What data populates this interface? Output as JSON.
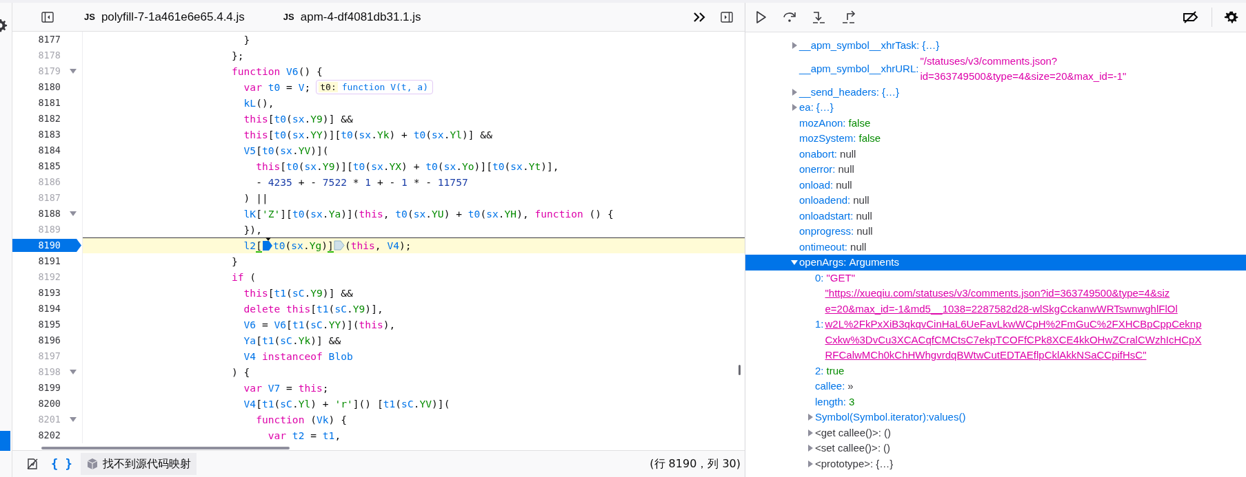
{
  "editor": {
    "tabs": [
      {
        "icon": "JS",
        "label": "polyfill-7-1a461e6e65.4.4.js",
        "selected": false
      },
      {
        "icon": "JS",
        "label": "apm-4-df4081db31.1.js",
        "selected": false
      }
    ],
    "lines": [
      {
        "number": "8177",
        "breakable": true,
        "tokens": [
          {
            "kind": "plain",
            "text": "  }"
          }
        ]
      },
      {
        "number": "8178",
        "breakable": false,
        "tokens": [
          {
            "kind": "plain",
            "text": "};"
          }
        ]
      },
      {
        "number": "8179",
        "breakable": false,
        "foldable": true,
        "tokens": [
          {
            "kind": "keyword",
            "text": "function"
          },
          {
            "kind": "name",
            "text": " V6"
          },
          {
            "kind": "plain",
            "text": "() {"
          }
        ]
      },
      {
        "number": "8180",
        "breakable": true,
        "tokens": [
          {
            "kind": "keyword",
            "text": "  var"
          },
          {
            "kind": "name",
            "text": " t0"
          },
          {
            "kind": "plain",
            "text": " = "
          },
          {
            "kind": "name",
            "text": "V"
          },
          {
            "kind": "plain",
            "text": ";"
          }
        ],
        "preview": {
          "name": "t0:",
          "value": "function V(t, a)"
        }
      },
      {
        "number": "8181",
        "breakable": true,
        "tokens": [
          {
            "kind": "name",
            "text": "  kL"
          },
          {
            "kind": "plain",
            "text": "(),"
          }
        ]
      },
      {
        "number": "8182",
        "breakable": true,
        "tokens": [
          {
            "kind": "keyword",
            "text": "  this"
          },
          {
            "kind": "plain",
            "text": "["
          },
          {
            "kind": "name",
            "text": "t0"
          },
          {
            "kind": "plain",
            "text": "("
          },
          {
            "kind": "name",
            "text": "sx"
          },
          {
            "kind": "plain",
            "text": "."
          },
          {
            "kind": "property",
            "text": "Y9"
          },
          {
            "kind": "plain",
            "text": ")] &&"
          }
        ]
      },
      {
        "number": "8183",
        "breakable": true,
        "tokens": [
          {
            "kind": "keyword",
            "text": "  this"
          },
          {
            "kind": "plain",
            "text": "["
          },
          {
            "kind": "name",
            "text": "t0"
          },
          {
            "kind": "plain",
            "text": "("
          },
          {
            "kind": "name",
            "text": "sx"
          },
          {
            "kind": "plain",
            "text": "."
          },
          {
            "kind": "property",
            "text": "YY"
          },
          {
            "kind": "plain",
            "text": ")]["
          },
          {
            "kind": "name",
            "text": "t0"
          },
          {
            "kind": "plain",
            "text": "("
          },
          {
            "kind": "name",
            "text": "sx"
          },
          {
            "kind": "plain",
            "text": "."
          },
          {
            "kind": "property",
            "text": "Yk"
          },
          {
            "kind": "plain",
            "text": ") + "
          },
          {
            "kind": "name",
            "text": "t0"
          },
          {
            "kind": "plain",
            "text": "("
          },
          {
            "kind": "name",
            "text": "sx"
          },
          {
            "kind": "plain",
            "text": "."
          },
          {
            "kind": "property",
            "text": "Yl"
          },
          {
            "kind": "plain",
            "text": ")] &&"
          }
        ]
      },
      {
        "number": "8184",
        "breakable": true,
        "tokens": [
          {
            "kind": "name",
            "text": "  V5"
          },
          {
            "kind": "plain",
            "text": "["
          },
          {
            "kind": "name",
            "text": "t0"
          },
          {
            "kind": "plain",
            "text": "("
          },
          {
            "kind": "name",
            "text": "sx"
          },
          {
            "kind": "plain",
            "text": "."
          },
          {
            "kind": "property",
            "text": "YV"
          },
          {
            "kind": "plain",
            "text": ")]("
          }
        ]
      },
      {
        "number": "8185",
        "breakable": true,
        "tokens": [
          {
            "kind": "keyword",
            "text": "    this"
          },
          {
            "kind": "plain",
            "text": "["
          },
          {
            "kind": "name",
            "text": "t0"
          },
          {
            "kind": "plain",
            "text": "("
          },
          {
            "kind": "name",
            "text": "sx"
          },
          {
            "kind": "plain",
            "text": "."
          },
          {
            "kind": "property",
            "text": "Y9"
          },
          {
            "kind": "plain",
            "text": ")]["
          },
          {
            "kind": "name",
            "text": "t0"
          },
          {
            "kind": "plain",
            "text": "("
          },
          {
            "kind": "name",
            "text": "sx"
          },
          {
            "kind": "plain",
            "text": "."
          },
          {
            "kind": "property",
            "text": "YX"
          },
          {
            "kind": "plain",
            "text": ") + "
          },
          {
            "kind": "name",
            "text": "t0"
          },
          {
            "kind": "plain",
            "text": "("
          },
          {
            "kind": "name",
            "text": "sx"
          },
          {
            "kind": "plain",
            "text": "."
          },
          {
            "kind": "property",
            "text": "Yo"
          },
          {
            "kind": "plain",
            "text": ")]["
          },
          {
            "kind": "name",
            "text": "t0"
          },
          {
            "kind": "plain",
            "text": "("
          },
          {
            "kind": "name",
            "text": "sx"
          },
          {
            "kind": "plain",
            "text": "."
          },
          {
            "kind": "property",
            "text": "Yt"
          },
          {
            "kind": "plain",
            "text": ")],"
          }
        ]
      },
      {
        "number": "8186",
        "breakable": false,
        "tokens": [
          {
            "kind": "plain",
            "text": "    - "
          },
          {
            "kind": "number",
            "text": "4235"
          },
          {
            "kind": "plain",
            "text": " + - "
          },
          {
            "kind": "number",
            "text": "7522"
          },
          {
            "kind": "plain",
            "text": " * "
          },
          {
            "kind": "number",
            "text": "1"
          },
          {
            "kind": "plain",
            "text": " + - "
          },
          {
            "kind": "number",
            "text": "1"
          },
          {
            "kind": "plain",
            "text": " * - "
          },
          {
            "kind": "number",
            "text": "11757"
          }
        ]
      },
      {
        "number": "8187",
        "breakable": false,
        "tokens": [
          {
            "kind": "plain",
            "text": "  ) ||"
          }
        ]
      },
      {
        "number": "8188",
        "breakable": true,
        "foldable": true,
        "tokens": [
          {
            "kind": "name",
            "text": "  lK"
          },
          {
            "kind": "plain",
            "text": "["
          },
          {
            "kind": "string",
            "text": "'Z'"
          },
          {
            "kind": "plain",
            "text": "]["
          },
          {
            "kind": "name",
            "text": "t0"
          },
          {
            "kind": "plain",
            "text": "("
          },
          {
            "kind": "name",
            "text": "sx"
          },
          {
            "kind": "plain",
            "text": "."
          },
          {
            "kind": "property",
            "text": "Ya"
          },
          {
            "kind": "plain",
            "text": ")]("
          },
          {
            "kind": "keyword",
            "text": "this"
          },
          {
            "kind": "plain",
            "text": ", "
          },
          {
            "kind": "name",
            "text": "t0"
          },
          {
            "kind": "plain",
            "text": "("
          },
          {
            "kind": "name",
            "text": "sx"
          },
          {
            "kind": "plain",
            "text": "."
          },
          {
            "kind": "property",
            "text": "YU"
          },
          {
            "kind": "plain",
            "text": ") + "
          },
          {
            "kind": "name",
            "text": "t0"
          },
          {
            "kind": "plain",
            "text": "("
          },
          {
            "kind": "name",
            "text": "sx"
          },
          {
            "kind": "plain",
            "text": "."
          },
          {
            "kind": "property",
            "text": "YH"
          },
          {
            "kind": "plain",
            "text": "), "
          },
          {
            "kind": "keyword",
            "text": "function"
          },
          {
            "kind": "plain",
            "text": " () {"
          }
        ]
      },
      {
        "number": "8189",
        "breakable": false,
        "tokens": [
          {
            "kind": "plain",
            "text": "  }),"
          }
        ]
      },
      {
        "number": "8190",
        "breakable": true,
        "paused": true,
        "tokens": [
          {
            "kind": "name",
            "text": "  l2"
          },
          {
            "kind": "bracket",
            "text": "["
          },
          {
            "kind": "column-breakpoint",
            "active": true
          },
          {
            "kind": "name",
            "text": "t0"
          },
          {
            "kind": "plain",
            "text": "("
          },
          {
            "kind": "name",
            "text": "sx"
          },
          {
            "kind": "plain",
            "text": "."
          },
          {
            "kind": "property",
            "text": "Yg"
          },
          {
            "kind": "plain",
            "text": ")"
          },
          {
            "kind": "bracket",
            "text": "]"
          },
          {
            "kind": "column-breakpoint",
            "active": false
          },
          {
            "kind": "plain",
            "text": "("
          },
          {
            "kind": "keyword",
            "text": "this"
          },
          {
            "kind": "plain",
            "text": ", "
          },
          {
            "kind": "name",
            "text": "V4"
          },
          {
            "kind": "plain",
            "text": ");"
          }
        ]
      },
      {
        "number": "8191",
        "breakable": true,
        "tokens": [
          {
            "kind": "plain",
            "text": "}"
          }
        ]
      },
      {
        "number": "8192",
        "breakable": false,
        "tokens": [
          {
            "kind": "keyword",
            "text": "if"
          },
          {
            "kind": "plain",
            "text": " ("
          }
        ]
      },
      {
        "number": "8193",
        "breakable": true,
        "tokens": [
          {
            "kind": "keyword",
            "text": "  this"
          },
          {
            "kind": "plain",
            "text": "["
          },
          {
            "kind": "name",
            "text": "t1"
          },
          {
            "kind": "plain",
            "text": "("
          },
          {
            "kind": "name",
            "text": "sC"
          },
          {
            "kind": "plain",
            "text": "."
          },
          {
            "kind": "property",
            "text": "Y9"
          },
          {
            "kind": "plain",
            "text": ")] &&"
          }
        ]
      },
      {
        "number": "8194",
        "breakable": true,
        "tokens": [
          {
            "kind": "keyword",
            "text": "  delete"
          },
          {
            "kind": "keyword",
            "text": " this"
          },
          {
            "kind": "plain",
            "text": "["
          },
          {
            "kind": "name",
            "text": "t1"
          },
          {
            "kind": "plain",
            "text": "("
          },
          {
            "kind": "name",
            "text": "sC"
          },
          {
            "kind": "plain",
            "text": "."
          },
          {
            "kind": "property",
            "text": "Y9"
          },
          {
            "kind": "plain",
            "text": ")],"
          }
        ]
      },
      {
        "number": "8195",
        "breakable": true,
        "tokens": [
          {
            "kind": "name",
            "text": "  V6"
          },
          {
            "kind": "plain",
            "text": " = "
          },
          {
            "kind": "name",
            "text": "V6"
          },
          {
            "kind": "plain",
            "text": "["
          },
          {
            "kind": "name",
            "text": "t1"
          },
          {
            "kind": "plain",
            "text": "("
          },
          {
            "kind": "name",
            "text": "sC"
          },
          {
            "kind": "plain",
            "text": "."
          },
          {
            "kind": "property",
            "text": "YY"
          },
          {
            "kind": "plain",
            "text": ")]("
          },
          {
            "kind": "keyword",
            "text": "this"
          },
          {
            "kind": "plain",
            "text": "),"
          }
        ]
      },
      {
        "number": "8196",
        "breakable": true,
        "tokens": [
          {
            "kind": "name",
            "text": "  Ya"
          },
          {
            "kind": "plain",
            "text": "["
          },
          {
            "kind": "name",
            "text": "t1"
          },
          {
            "kind": "plain",
            "text": "("
          },
          {
            "kind": "name",
            "text": "sC"
          },
          {
            "kind": "plain",
            "text": "."
          },
          {
            "kind": "property",
            "text": "Yk"
          },
          {
            "kind": "plain",
            "text": ")] &&"
          }
        ]
      },
      {
        "number": "8197",
        "breakable": false,
        "tokens": [
          {
            "kind": "name",
            "text": "  V4"
          },
          {
            "kind": "keyword",
            "text": " instanceof"
          },
          {
            "kind": "name",
            "text": " Blob"
          }
        ]
      },
      {
        "number": "8198",
        "breakable": false,
        "foldable": true,
        "tokens": [
          {
            "kind": "plain",
            "text": ") {"
          }
        ]
      },
      {
        "number": "8199",
        "breakable": true,
        "tokens": [
          {
            "kind": "keyword",
            "text": "  var"
          },
          {
            "kind": "name",
            "text": " V7"
          },
          {
            "kind": "plain",
            "text": " = "
          },
          {
            "kind": "keyword",
            "text": "this"
          },
          {
            "kind": "plain",
            "text": ";"
          }
        ]
      },
      {
        "number": "8200",
        "breakable": true,
        "tokens": [
          {
            "kind": "name",
            "text": "  V4"
          },
          {
            "kind": "plain",
            "text": "["
          },
          {
            "kind": "name",
            "text": "t1"
          },
          {
            "kind": "plain",
            "text": "("
          },
          {
            "kind": "name",
            "text": "sC"
          },
          {
            "kind": "plain",
            "text": "."
          },
          {
            "kind": "property",
            "text": "Yl"
          },
          {
            "kind": "plain",
            "text": ") + "
          },
          {
            "kind": "string",
            "text": "'r'"
          },
          {
            "kind": "plain",
            "text": "]() ["
          },
          {
            "kind": "name",
            "text": "t1"
          },
          {
            "kind": "plain",
            "text": "("
          },
          {
            "kind": "name",
            "text": "sC"
          },
          {
            "kind": "plain",
            "text": "."
          },
          {
            "kind": "property",
            "text": "YV"
          },
          {
            "kind": "plain",
            "text": ")]("
          }
        ]
      },
      {
        "number": "8201",
        "breakable": false,
        "foldable": true,
        "tokens": [
          {
            "kind": "keyword",
            "text": "    function"
          },
          {
            "kind": "plain",
            "text": " ("
          },
          {
            "kind": "name",
            "text": "Vk"
          },
          {
            "kind": "plain",
            "text": ") {"
          }
        ]
      },
      {
        "number": "8202",
        "breakable": true,
        "tokens": [
          {
            "kind": "keyword",
            "text": "      var"
          },
          {
            "kind": "name",
            "text": " t2"
          },
          {
            "kind": "plain",
            "text": " = "
          },
          {
            "kind": "name",
            "text": "t1"
          },
          {
            "kind": "plain",
            "text": ","
          }
        ]
      }
    ],
    "status": {
      "format_label": "{ }",
      "source_map_label": "找不到源代码映射",
      "position": "(行 8190，列 30)"
    }
  },
  "debugger": {
    "scopes": [
      {
        "name": "__apm_symbol__xhrTask:",
        "value": "{…}",
        "kind": "object",
        "expanded": false,
        "selected": false
      },
      {
        "name": "__apm_symbol__xhrURL:",
        "lines": [
          "\"/statuses/v3/comments.json?",
          "id=363749500&type=4&size=20&max_id=-1\""
        ],
        "kind": "string",
        "selected": false
      },
      {
        "name": "__send_headers:",
        "value": "{…}",
        "kind": "object",
        "expanded": false,
        "selected": false
      },
      {
        "name": "ea:",
        "value": "{…}",
        "kind": "object",
        "expanded": false,
        "selected": false
      },
      {
        "name": "mozAnon:",
        "value": "false",
        "kind": "boolean",
        "selected": false
      },
      {
        "name": "mozSystem:",
        "value": "false",
        "kind": "boolean",
        "selected": false
      },
      {
        "name": "onabort:",
        "value": "null",
        "kind": "null",
        "selected": false
      },
      {
        "name": "onerror:",
        "value": "null",
        "kind": "null",
        "selected": false
      },
      {
        "name": "onload:",
        "value": "null",
        "kind": "null",
        "selected": false
      },
      {
        "name": "onloadend:",
        "value": "null",
        "kind": "null",
        "selected": false
      },
      {
        "name": "onloadstart:",
        "value": "null",
        "kind": "null",
        "selected": false
      },
      {
        "name": "onprogress:",
        "value": "null",
        "kind": "null",
        "selected": false
      },
      {
        "name": "ontimeout:",
        "value": "null",
        "kind": "null",
        "selected": false
      },
      {
        "name": "openArgs:",
        "value": "Arguments",
        "kind": "class",
        "expanded": true,
        "selected": true,
        "children": [
          {
            "name": "0:",
            "value": "\"GET\"",
            "kind": "string",
            "internal": false,
            "selected": false
          },
          {
            "name": "1:",
            "lines": [
              "\"https://xueqiu.com/statuses/v3/comments.json?id=363749500&type=4&siz",
              "e=20&max_id=-1&md5__1038=2287582d28-wlSkgCckanwWRTswnwghlFlOl",
              "w2L%2FkPxXiB3qkqvCinHaL6UeFavLkwWCpH%2FmGuC%2FXHCBpCppCeknp",
              "Cxkw%3DvCu3XCACqfCMCtsC7ekpTCOFfCPk8XCE4kkOHwZCralCWzhIcHCpX",
              "RFCalwMCh0kChHWhgvrdqBWtwCutEDTAEflpCklAkkNSaCCpifHsC\""
            ],
            "kind": "url",
            "internal": false,
            "selected": false
          },
          {
            "name": "2:",
            "value": "true",
            "kind": "boolean",
            "internal": false,
            "selected": false
          },
          {
            "name": "callee:",
            "value": "»",
            "kind": "plain",
            "internal": false,
            "selected": false
          },
          {
            "name": "length:",
            "value": "3",
            "kind": "number",
            "internal": false,
            "selected": false
          },
          {
            "name": "Symbol(Symbol.iterator):values()",
            "internal": false,
            "expanded": false,
            "selected": false
          },
          {
            "name": "<get callee()>:",
            "value": "()",
            "kind": "plain",
            "internal": true,
            "expanded": false,
            "selected": false
          },
          {
            "name": "<set callee()>:",
            "value": "()",
            "kind": "plain",
            "internal": true,
            "expanded": false,
            "selected": false
          },
          {
            "name": "<prototype>:",
            "value": "{…}",
            "kind": "plain",
            "internal": true,
            "expanded": false,
            "selected": false
          }
        ]
      }
    ]
  }
}
